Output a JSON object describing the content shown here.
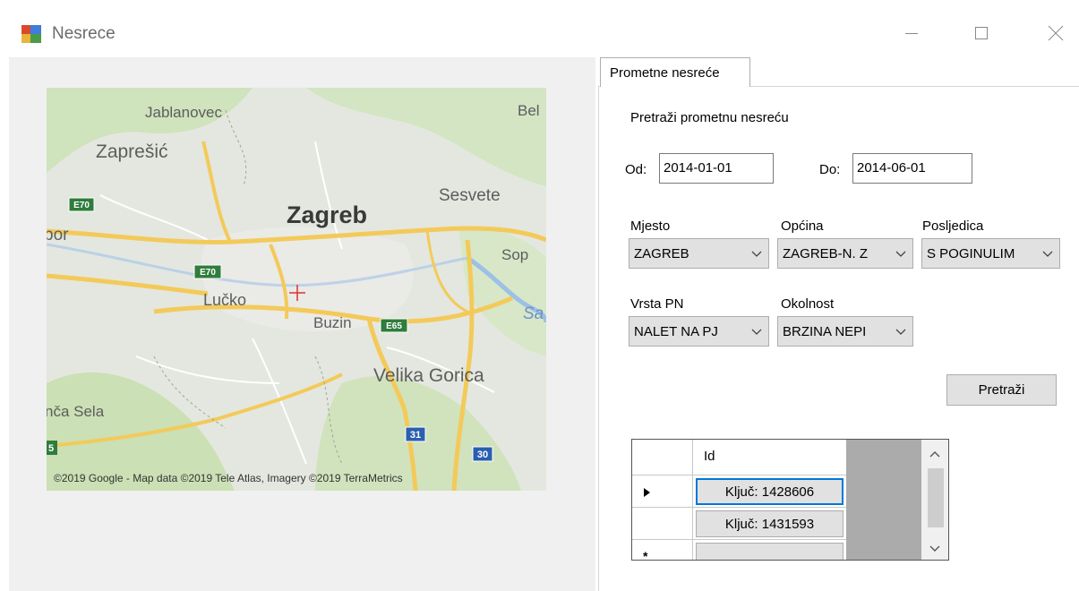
{
  "window": {
    "title": "Nesrece",
    "app_icon": "app-icon",
    "controls": [
      "minimize-icon",
      "maximize-icon",
      "close-icon"
    ]
  },
  "map": {
    "labels": {
      "jablanovec": "Jablanovec",
      "bel": "Bel",
      "zapresic": "Zaprešić",
      "sesvete": "Sesvete",
      "zagreb": "Zagreb",
      "bor": "bor",
      "sop": "Sop",
      "sa": "Sa",
      "lucko": "Lučko",
      "buzin": "Buzin",
      "velika_gorica": "Velika Gorica",
      "nca_sela": "nča Sela"
    },
    "road_shields": {
      "e70_left": "E70",
      "e70_mid": "E70",
      "e65": "E65",
      "r31": "31",
      "r30": "30",
      "r5": "5"
    },
    "attribution": "©2019 Google - Map data ©2019 Tele Atlas, Imagery ©2019 TerraMetrics",
    "marker": "crosshair-marker-icon"
  },
  "tab": {
    "label": "Prometne nesreće"
  },
  "form": {
    "section_title": "Pretraži prometnu nesreću",
    "od_label": "Od:",
    "od_value": "2014-01-01",
    "do_label": "Do:",
    "do_value": "2014-06-01",
    "mjesto_label": "Mjesto",
    "mjesto_value": "ZAGREB",
    "opcina_label": "Općina",
    "opcina_value": "ZAGREB-N. Z",
    "posljedica_label": "Posljedica",
    "posljedica_value": "S POGINULIM",
    "vrsta_label": "Vrsta PN",
    "vrsta_value": "NALET NA PJ",
    "okolnost_label": "Okolnost",
    "okolnost_value": "BRZINA NEPI",
    "search_button": "Pretraži"
  },
  "grid": {
    "column_header": "Id",
    "rows": [
      {
        "value": "Ključ: 1428606",
        "current": true
      },
      {
        "value": "Ključ: 1431593",
        "current": false
      },
      {
        "value": "",
        "new_row": true
      }
    ]
  },
  "colors": {
    "map_land": "#e4e7df",
    "map_green": "#c9dfb3",
    "road": "#f5cf63",
    "shield_green": "#2f7d3c",
    "shield_blue": "#2a5fb0",
    "selection_blue": "#0078d7"
  }
}
